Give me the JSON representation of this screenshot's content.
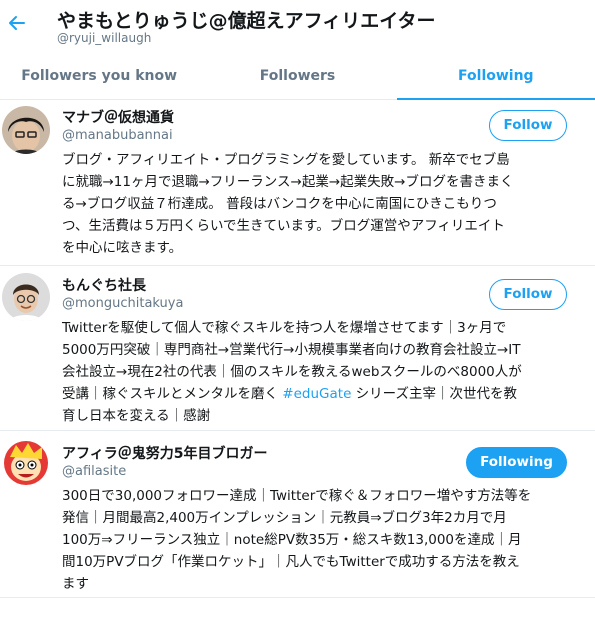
{
  "header": {
    "title": "やまもとりゅうじ@億超えアフィリエイター",
    "handle": "@ryuji_willaugh",
    "back_icon": "back-arrow-icon"
  },
  "tabs": [
    {
      "label": "Followers you know",
      "active": false
    },
    {
      "label": "Followers",
      "active": false
    },
    {
      "label": "Following",
      "active": true
    }
  ],
  "users": [
    {
      "name": "マナブ＠仮想通貨",
      "handle": "@manabubannai",
      "button": "Follow",
      "bio_lines": [
        "ブログ・アフィリエイト・プログラミングを愛しています。 新卒でセブ島",
        "に就職→11ヶ月で退職→フリーランス→起業→起業失敗→ブログを書きまく",
        "る→ブログ収益７桁達成。 普段はバンコクを中心に南国にひきこもりつ",
        "つ、生活費は５万円くらいで生きています。ブログ運営やアフィリエイト",
        "を中心に呟きます。"
      ]
    },
    {
      "name": "もんぐち社長",
      "handle": "@monguchitakuya",
      "button": "Follow",
      "bio_lines": [
        "Twitterを駆使して個人で稼ぐスキルを持つ人を爆増させてます｜3ヶ月で",
        "5000万円突破｜専門商社→営業代行→小規模事業者向けの教育会社設立→IT",
        "会社設立→現在2社の代表｜個のスキルを教えるwebスクールのべ8000人が",
        "受講｜稼ぐスキルとメンタルを磨く",
        "育し日本を変える｜感謝"
      ],
      "hashtag": "#eduGate",
      "bio_line4_tail": " シリーズ主宰｜次世代を教"
    },
    {
      "name": "アフィラ＠鬼努力5年目ブロガー",
      "handle": "@afilasite",
      "button": "Following",
      "bio_lines": [
        "300日で30,000フォロワー達成｜Twitterで稼ぐ＆フォロワー増やす方法等を",
        "発信｜月間最高2,400万インプレッション｜元教員⇒ブログ3年2カ月で月",
        "100万⇒フリーランス独立｜note総PV数35万・総スキ数13,000を達成｜月",
        "間10万PVブログ「作業ロケット」｜凡人でもTwitterで成功する方法を教え",
        "ます"
      ]
    }
  ],
  "colors": {
    "accent": "#1da1f2",
    "text": "#14171a",
    "muted": "#657786",
    "divider": "#e6ecf0"
  }
}
